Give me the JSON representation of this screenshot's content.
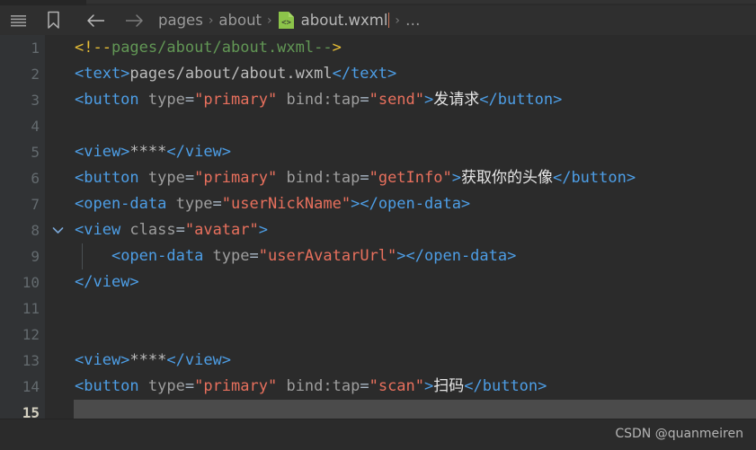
{
  "window": {
    "theme_bg": "#2b2b2b",
    "gutter_bg": "#313335",
    "toolbar_bg": "#2f2f2f",
    "active_line_bg": "#4b4b4b"
  },
  "toolbar": {
    "menu_icon": "hamburger-menu-icon",
    "bookmark_icon": "bookmark-icon",
    "back_icon": "arrow-left-icon",
    "forward_icon": "arrow-right-icon",
    "breadcrumb": {
      "items": [
        {
          "label": "pages",
          "type": "folder"
        },
        {
          "label": "about",
          "type": "folder"
        },
        {
          "label": "about.wxml",
          "type": "file",
          "icon": "wxml-file-icon"
        }
      ],
      "separator": "›",
      "trailing": "…"
    }
  },
  "editor": {
    "active_line": 15,
    "lines": [
      {
        "n": "1",
        "fold": "",
        "indent_guide": false,
        "tokens": [
          {
            "t": "<!--",
            "c": "t-cmtdelim"
          },
          {
            "t": "pages/about/about.wxml",
            "c": "t-cmt"
          },
          {
            "t": "--",
            "c": "t-cmt"
          },
          {
            "t": ">",
            "c": "t-cmtdelim"
          }
        ]
      },
      {
        "n": "2",
        "fold": "",
        "indent_guide": false,
        "tokens": [
          {
            "t": "<text>",
            "c": "t-tag"
          },
          {
            "t": "pages/about/about.wxml",
            "c": "t-plain"
          },
          {
            "t": "</text>",
            "c": "t-tag"
          }
        ]
      },
      {
        "n": "3",
        "fold": "",
        "indent_guide": false,
        "tokens": [
          {
            "t": "<button",
            "c": "t-tag"
          },
          {
            "t": " type",
            "c": "t-attr"
          },
          {
            "t": "=",
            "c": "t-eq"
          },
          {
            "t": "\"primary\"",
            "c": "t-str"
          },
          {
            "t": " bind:tap",
            "c": "t-attr"
          },
          {
            "t": "=",
            "c": "t-eq"
          },
          {
            "t": "\"send\"",
            "c": "t-str"
          },
          {
            "t": ">",
            "c": "t-tag"
          },
          {
            "t": "发请求",
            "c": "t-cjk"
          },
          {
            "t": "</button>",
            "c": "t-tag"
          }
        ]
      },
      {
        "n": "4",
        "fold": "",
        "indent_guide": false,
        "tokens": []
      },
      {
        "n": "5",
        "fold": "",
        "indent_guide": false,
        "tokens": [
          {
            "t": "<view>",
            "c": "t-tag"
          },
          {
            "t": "****",
            "c": "t-plain"
          },
          {
            "t": "</view>",
            "c": "t-tag"
          }
        ]
      },
      {
        "n": "6",
        "fold": "",
        "indent_guide": false,
        "tokens": [
          {
            "t": "<button",
            "c": "t-tag"
          },
          {
            "t": " type",
            "c": "t-attr"
          },
          {
            "t": "=",
            "c": "t-eq"
          },
          {
            "t": "\"primary\"",
            "c": "t-str"
          },
          {
            "t": " bind:tap",
            "c": "t-attr"
          },
          {
            "t": "=",
            "c": "t-eq"
          },
          {
            "t": "\"getInfo\"",
            "c": "t-str"
          },
          {
            "t": ">",
            "c": "t-tag"
          },
          {
            "t": "获取你的头像",
            "c": "t-cjk"
          },
          {
            "t": "</button>",
            "c": "t-tag"
          }
        ]
      },
      {
        "n": "7",
        "fold": "",
        "indent_guide": false,
        "tokens": [
          {
            "t": "<open-data",
            "c": "t-tag"
          },
          {
            "t": " type",
            "c": "t-attr"
          },
          {
            "t": "=",
            "c": "t-eq"
          },
          {
            "t": "\"userNickName\"",
            "c": "t-str"
          },
          {
            "t": ">",
            "c": "t-tag"
          },
          {
            "t": "</open-data>",
            "c": "t-tag"
          }
        ]
      },
      {
        "n": "8",
        "fold": "chevron-down",
        "indent_guide": false,
        "tokens": [
          {
            "t": "<view",
            "c": "t-tag"
          },
          {
            "t": " class",
            "c": "t-attr"
          },
          {
            "t": "=",
            "c": "t-eq"
          },
          {
            "t": "\"avatar\"",
            "c": "t-str"
          },
          {
            "t": ">",
            "c": "t-tag"
          }
        ]
      },
      {
        "n": "9",
        "fold": "",
        "indent_guide": true,
        "tokens": [
          {
            "t": "    ",
            "c": "t-plain"
          },
          {
            "t": "<open-data",
            "c": "t-tag"
          },
          {
            "t": " type",
            "c": "t-attr"
          },
          {
            "t": "=",
            "c": "t-eq"
          },
          {
            "t": "\"userAvatarUrl\"",
            "c": "t-str"
          },
          {
            "t": ">",
            "c": "t-tag"
          },
          {
            "t": "</open-data>",
            "c": "t-tag"
          }
        ]
      },
      {
        "n": "10",
        "fold": "",
        "indent_guide": false,
        "tokens": [
          {
            "t": "</view>",
            "c": "t-tag"
          }
        ]
      },
      {
        "n": "11",
        "fold": "",
        "indent_guide": false,
        "tokens": []
      },
      {
        "n": "12",
        "fold": "",
        "indent_guide": false,
        "tokens": []
      },
      {
        "n": "13",
        "fold": "",
        "indent_guide": false,
        "tokens": [
          {
            "t": "<view>",
            "c": "t-tag"
          },
          {
            "t": "****",
            "c": "t-plain"
          },
          {
            "t": "</view>",
            "c": "t-tag"
          }
        ]
      },
      {
        "n": "14",
        "fold": "",
        "indent_guide": false,
        "tokens": [
          {
            "t": "<button",
            "c": "t-tag"
          },
          {
            "t": " type",
            "c": "t-attr"
          },
          {
            "t": "=",
            "c": "t-eq"
          },
          {
            "t": "\"primary\"",
            "c": "t-str"
          },
          {
            "t": " bind:tap",
            "c": "t-attr"
          },
          {
            "t": "=",
            "c": "t-eq"
          },
          {
            "t": "\"scan\"",
            "c": "t-str"
          },
          {
            "t": ">",
            "c": "t-tag"
          },
          {
            "t": "扫码",
            "c": "t-cjk"
          },
          {
            "t": "</button>",
            "c": "t-tag"
          }
        ]
      },
      {
        "n": "15",
        "fold": "",
        "indent_guide": false,
        "tokens": []
      }
    ]
  },
  "watermark": {
    "text": "CSDN @quanmeiren"
  }
}
